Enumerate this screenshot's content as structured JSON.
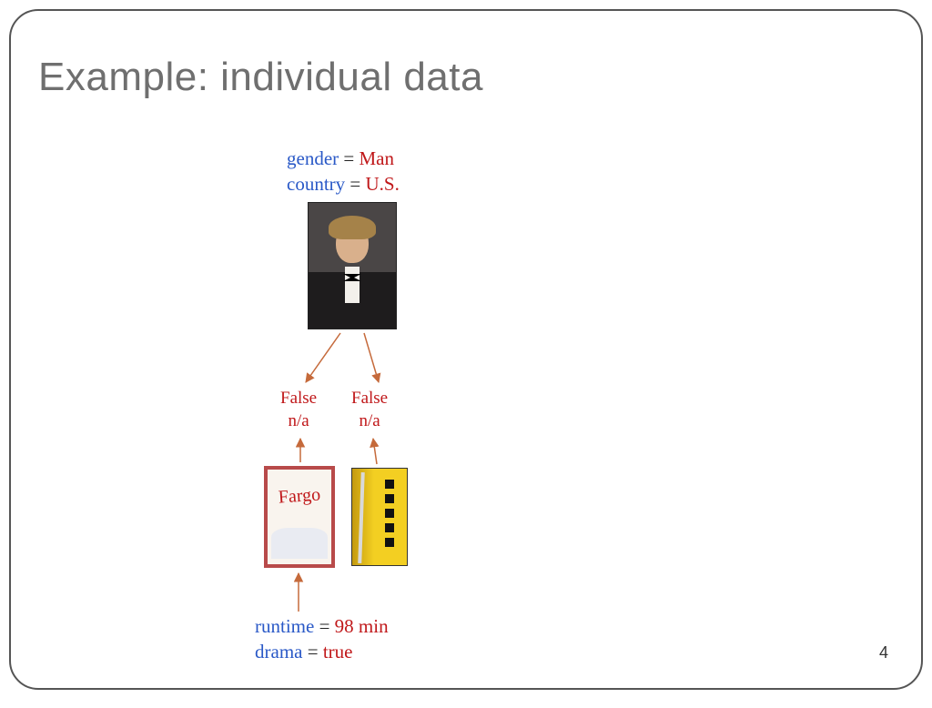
{
  "title": "Example: individual data",
  "page_number": "4",
  "person_attrs": [
    {
      "key": "gender",
      "val": "Man"
    },
    {
      "key": "country",
      "val": "U.S."
    }
  ],
  "edge_labels": {
    "left": "False\nn/a",
    "right": "False\nn/a"
  },
  "movie_attrs": [
    {
      "key": "runtime",
      "val": "98 min"
    },
    {
      "key": "drama",
      "val": "true"
    }
  ],
  "poster1_title": "Fargo",
  "colors": {
    "key": "#2a59c7",
    "val": "#c0181a",
    "arrow": "#c56a3b"
  }
}
